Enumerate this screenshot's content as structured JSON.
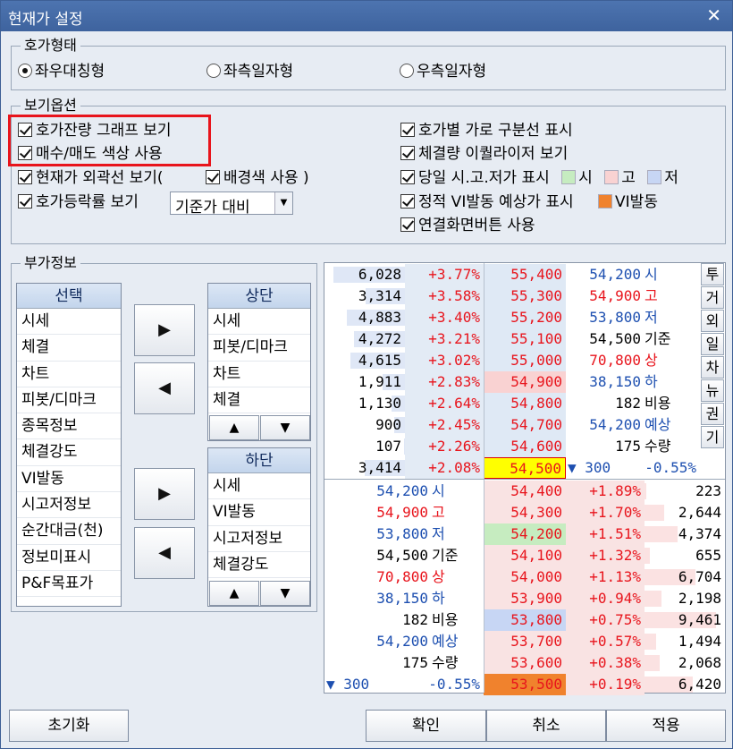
{
  "window": {
    "title": "현재가 설정",
    "close_glyph": "✕"
  },
  "hoga_type": {
    "legend": "호가형태",
    "options": [
      "좌우대칭형",
      "좌측일자형",
      "우측일자형"
    ],
    "selected_index": 0
  },
  "view_options": {
    "legend": "보기옵션",
    "left": [
      {
        "label": "호가잔량 그래프 보기",
        "checked": true
      },
      {
        "label": "매수/매도 색상 사용",
        "checked": true
      },
      {
        "label": "현재가 외곽선 보기(",
        "checked": true
      },
      {
        "label": "호가등락률 보기",
        "checked": true
      }
    ],
    "bg_color_label": "배경색 사용 )",
    "bg_color_checked": true,
    "rate_select_value": "기준가 대비",
    "right": [
      {
        "label": "호가별 가로 구분선 표시",
        "checked": true
      },
      {
        "label": "체결량 이퀄라이저 보기",
        "checked": true
      },
      {
        "label": "당일 시.고.저가 표시",
        "checked": true
      },
      {
        "label": "정적 VI발동 예상가 표시",
        "checked": true
      },
      {
        "label": "연결화면버튼 사용",
        "checked": true
      }
    ],
    "swatches": [
      {
        "label": "시",
        "color": "#c6ecc0"
      },
      {
        "label": "고",
        "color": "#f9d2d2"
      },
      {
        "label": "저",
        "color": "#c7d6f4"
      }
    ],
    "vi_swatch": {
      "label": "VI발동",
      "color": "#f0822d"
    }
  },
  "extra_info": {
    "legend": "부가정보",
    "select_list": {
      "header": "선택",
      "items": [
        "시세",
        "체결",
        "차트",
        "피봇/디마크",
        "종목정보",
        "체결강도",
        "VI발동",
        "시고저정보",
        "순간대금(천)",
        "정보미표시",
        "P&F목표가"
      ]
    },
    "top_list": {
      "header": "상단",
      "items": [
        "시세",
        "피봇/디마크",
        "차트",
        "체결"
      ]
    },
    "bottom_list": {
      "header": "하단",
      "items": [
        "시세",
        "VI발동",
        "시고저정보",
        "체결강도"
      ]
    },
    "arrow_right": "▶",
    "arrow_left": "◀",
    "arrow_up": "▲",
    "arrow_down": "▼"
  },
  "preview": {
    "ask_rows": [
      {
        "qty": "6,028",
        "rate": "+3.77%",
        "price": "55,400"
      },
      {
        "qty": "3,314",
        "rate": "+3.58%",
        "price": "55,300"
      },
      {
        "qty": "4,883",
        "rate": "+3.40%",
        "price": "55,200"
      },
      {
        "qty": "4,272",
        "rate": "+3.21%",
        "price": "55,100"
      },
      {
        "qty": "4,615",
        "rate": "+3.02%",
        "price": "55,000"
      },
      {
        "qty": "1,911",
        "rate": "+2.83%",
        "price": "54,900"
      },
      {
        "qty": "1,130",
        "rate": "+2.64%",
        "price": "54,800"
      },
      {
        "qty": "900",
        "rate": "+2.45%",
        "price": "54,700"
      },
      {
        "qty": "107",
        "rate": "+2.26%",
        "price": "54,600"
      },
      {
        "qty": "3,414",
        "rate": "+2.08%",
        "price": "54,500"
      }
    ],
    "bid_rows": [
      {
        "price": "54,400",
        "rate": "+1.89%",
        "qty": "223"
      },
      {
        "price": "54,300",
        "rate": "+1.70%",
        "qty": "2,644"
      },
      {
        "price": "54,200",
        "rate": "+1.51%",
        "qty": "4,374"
      },
      {
        "price": "54,100",
        "rate": "+1.32%",
        "qty": "655"
      },
      {
        "price": "54,000",
        "rate": "+1.13%",
        "qty": "6,704"
      },
      {
        "price": "53,900",
        "rate": "+0.94%",
        "qty": "2,198"
      },
      {
        "price": "53,800",
        "rate": "+0.75%",
        "qty": "9,461"
      },
      {
        "price": "53,700",
        "rate": "+0.57%",
        "qty": "1,494"
      },
      {
        "price": "53,600",
        "rate": "+0.38%",
        "qty": "2,068"
      },
      {
        "price": "53,500",
        "rate": "+0.19%",
        "qty": "6,420"
      }
    ],
    "info": [
      {
        "value": "54,200",
        "label": "시",
        "color": "blue"
      },
      {
        "value": "54,900",
        "label": "고",
        "color": "red"
      },
      {
        "value": "53,800",
        "label": "저",
        "color": "blue"
      },
      {
        "value": "54,500",
        "label": "기준",
        "color": "black"
      },
      {
        "value": "70,800",
        "label": "상",
        "color": "red"
      },
      {
        "value": "38,150",
        "label": "하",
        "color": "blue"
      },
      {
        "value": "182",
        "label": "비용",
        "color": "black"
      },
      {
        "value": "54,200",
        "label": "예상",
        "color": "blue"
      },
      {
        "value": "175",
        "label": "수량",
        "color": "black"
      }
    ],
    "change": {
      "arrow": "▼",
      "amount": "300",
      "rate": "-0.55%"
    },
    "side_tabs": [
      "투",
      "거",
      "외",
      "일",
      "차",
      "뉴",
      "권",
      "기"
    ]
  },
  "buttons": {
    "reset": "초기화",
    "ok": "확인",
    "cancel": "취소",
    "apply": "적용"
  }
}
